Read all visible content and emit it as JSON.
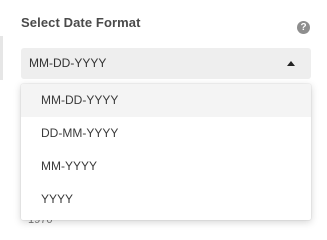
{
  "field": {
    "title": "Select Date Format",
    "help_icon": "question-circle-icon",
    "help_glyph": "?"
  },
  "select": {
    "value": "MM-DD-YYYY",
    "caret_icon": "caret-up-icon"
  },
  "dropdown": {
    "options": [
      {
        "label": "MM-DD-YYYY",
        "selected": true
      },
      {
        "label": "DD-MM-YYYY",
        "selected": false
      },
      {
        "label": "MM-YYYY",
        "selected": false
      },
      {
        "label": "YYYY",
        "selected": false
      }
    ]
  },
  "background_fragment": "1970",
  "colors": {
    "select_bg": "#eeeeee",
    "selected_option_bg": "#f4f4f4",
    "help_icon": "#8e8e8e"
  }
}
